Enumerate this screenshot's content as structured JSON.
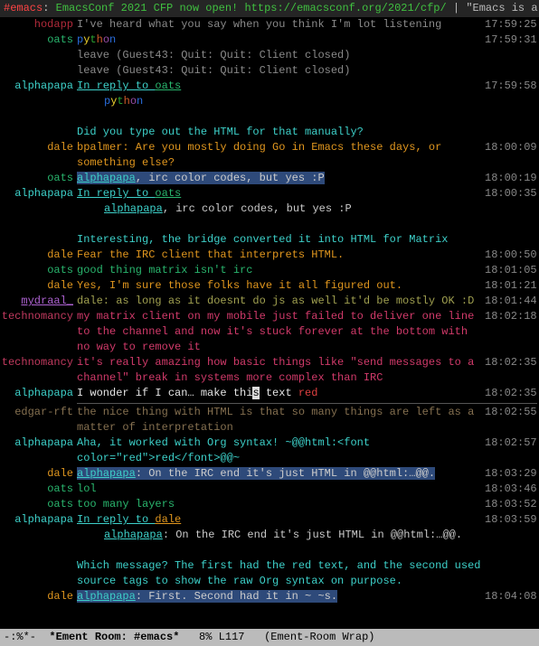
{
  "header": {
    "channel": "#emacs",
    "sep1": ": ",
    "topic": "EmacsConf 2021 CFP now open! https://emacsconf.org/2021/cfp/",
    "sep2": " | ",
    "tail": "\"Emacs is a co"
  },
  "nicks": {
    "hodapp": "hodapp",
    "oats": "oats",
    "alphapapa": "alphapapa",
    "dale": "dale",
    "mydraal": "mydraal_",
    "technomancy": "technomancy",
    "edgarrft": "edgar-rft"
  },
  "msgs": {
    "m01": "I've heard what you say when you think I'm lot listening",
    "leave1": "leave (Guest43: Quit: Quit: Client closed)",
    "leave2": "leave (Guest43: Quit: Quit: Client closed)",
    "reply1": "In reply to ",
    "reply_oats": "oats",
    "m_html_q": "Did you type out the HTML for that manually?",
    "m_bpalmer": "bpalmer: Are you mostly doing Go in Emacs these days, or something else?",
    "m_irc_codes_pre": "alphapapa",
    "m_irc_codes_post": ", irc color codes, but yes :P",
    "m_irc2_pre": "alphapapa",
    "m_irc2_post": ", irc color codes, but yes :P",
    "m_bridge": "Interesting, the bridge converted it into HTML for Matrix",
    "m_fear": "Fear the IRC client that interprets HTML.",
    "m_matrix_irc": "good thing matrix isn't irc",
    "m_sure": "Yes, I'm sure those folks have it all figured out.",
    "m_mydraal": "dale: as long as it doesnt do js as well it'd be mostly OK :D",
    "m_techno1": "my matrix client on my mobile just failed to deliver one line to the channel and now it's stuck forever at the bottom with no way to remove it",
    "m_techno2": "it's really amazing how basic things like \"send messages to a channel\" break in systems more complex than IRC",
    "m_wonder_a": "I wonder if I can… make thi",
    "m_wonder_s": "s",
    "m_wonder_b": " text ",
    "m_wonder_c": "red",
    "m_edgar": "the nice thing with HTML is that so many things are left as a matter of interpretation",
    "m_orgsyntax": "Aha, it worked with Org syntax!  ~@@html:<font color=\"red\">red</font>@@~",
    "m_dale_end": "alphapapa",
    "m_dale_end2": ": On the IRC end it's just HTML in @@html:…@@.",
    "m_lol": "lol",
    "m_layers": "too many layers",
    "reply_dale": "dale",
    "m_which": "Which message? The first had the red text, and the second used source tags to show the raw Org syntax on purpose.",
    "m_first": ": First. Second had it in ~ ~s."
  },
  "times": {
    "t01": "17:59:25",
    "t02": "17:59:31",
    "t03": "17:59:58",
    "t04": "18:00:09",
    "t05": "18:00:19",
    "t06": "18:00:35",
    "t07": "18:00:50",
    "t08": "18:01:05",
    "t09": "18:01:21",
    "t10": "18:01:44",
    "t11": "18:02:18",
    "t12": "18:02:35",
    "t13": "18:02:35",
    "t14": "18:02:55",
    "t15": "18:02:57",
    "t16": "18:03:29",
    "t17": "18:03:46",
    "t18": "18:03:52",
    "t19": "18:03:59",
    "t20": "18:04:08"
  },
  "modeline": {
    "left": "-:%*-  ",
    "room": "*Ement Room: #emacs*",
    "mid": "   8% L117   (Ement-Room Wrap)"
  }
}
